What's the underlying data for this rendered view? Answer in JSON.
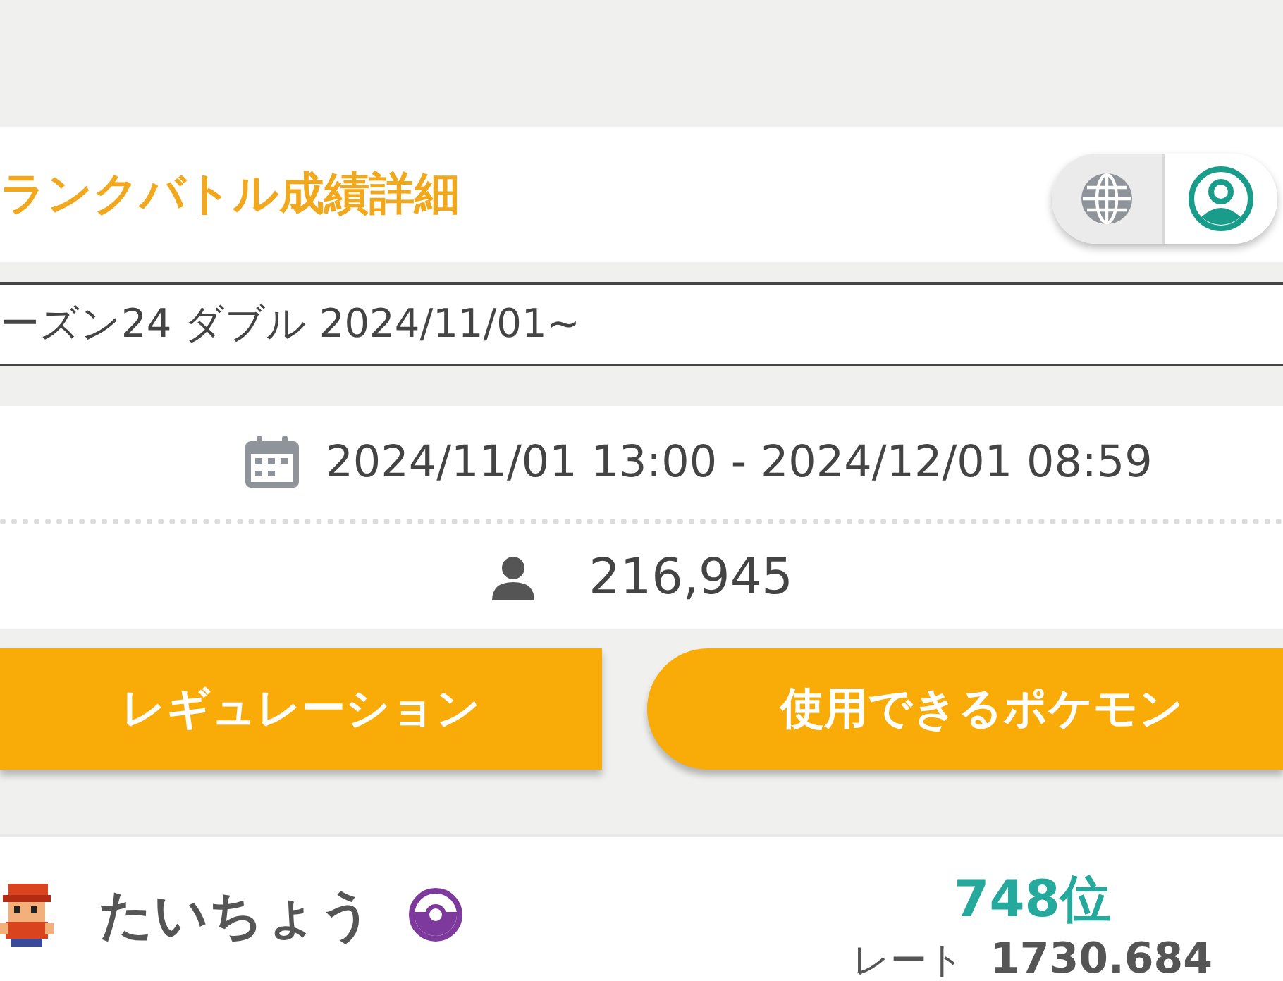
{
  "header": {
    "title": "ランクバトル成績詳細"
  },
  "season_select": {
    "value": "ーズン24 ダブル 2024/11/01~"
  },
  "season": {
    "period": "2024/11/01 13:00 - 2024/12/01 08:59",
    "players": "216,945"
  },
  "buttons": [
    "レギュレーション",
    "使用できるポケモン"
  ],
  "player": {
    "name": "たいちょう",
    "rank": "748位",
    "rate_label": "レート",
    "rate": "1730.684"
  }
}
